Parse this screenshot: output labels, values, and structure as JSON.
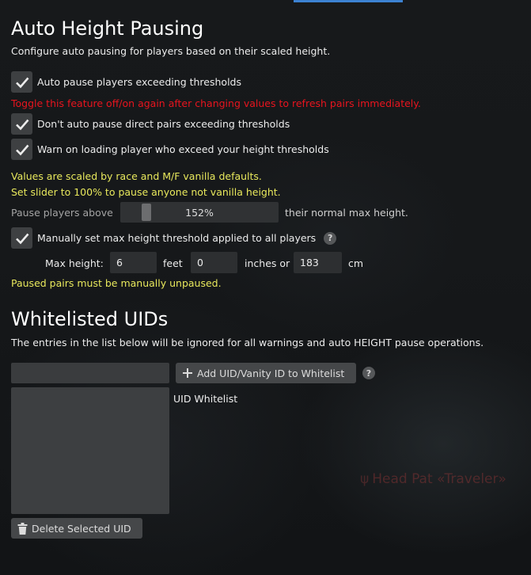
{
  "auto_height": {
    "title": "Auto Height Pausing",
    "description": "Configure auto pausing for players based on their scaled height.",
    "auto_pause_label": "Auto pause players exceeding thresholds",
    "toggle_warning": "Toggle this feature off/on again after changing values to refresh pairs immediately.",
    "direct_pairs_label": "Don't auto pause direct pairs exceeding thresholds",
    "warn_loading_label": "Warn on loading player who exceed your height thresholds",
    "scale_note_1": "Values are scaled by race and M/F vanilla defaults.",
    "scale_note_2": "Set slider to 100% to pause anyone not vanilla height.",
    "slider_label": "Pause players above",
    "slider_value": "152%",
    "slider_fraction": 0.13,
    "slider_suffix": "their normal max height.",
    "manual_label": "Manually set max height threshold applied to all players",
    "help_glyph": "?",
    "max_height_label": "Max height:",
    "feet_value": "6",
    "feet_unit": "feet",
    "inches_value": "0",
    "inches_unit": "inches or",
    "cm_value": "183",
    "cm_unit": "cm",
    "paused_note": "Paused pairs must be manually unpaused."
  },
  "whitelist": {
    "title": "Whitelisted UIDs",
    "description": "The entries in the list below will be ignored for all warnings and auto HEIGHT pause operations.",
    "input_value": "",
    "add_button": "Add UID/Vanity ID to Whitelist",
    "list_label": "UID Whitelist",
    "delete_button": "Delete Selected UID",
    "help_glyph": "?"
  },
  "background": {
    "watermark": "Head Pat «Traveler»"
  },
  "colors": {
    "accent": "#3c82d2",
    "warning_red": "#e8141e",
    "note_yellow": "#e8e85c"
  },
  "icons": [
    "checkmark-icon",
    "plus-icon",
    "trash-icon",
    "help-icon"
  ]
}
